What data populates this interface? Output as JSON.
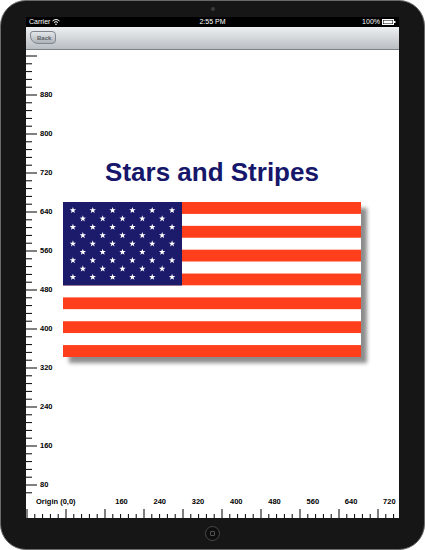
{
  "status_bar": {
    "carrier": "Carrier",
    "time": "2:55 PM",
    "battery": "100%",
    "battery_level": 1
  },
  "nav_bar": {
    "back_button": "Back"
  },
  "title": "Stars and Stripes",
  "vertical_ruler": {
    "labels": [
      "880",
      "800",
      "720",
      "640",
      "560",
      "480",
      "400",
      "320",
      "240",
      "160",
      "80"
    ]
  },
  "horizontal_ruler": {
    "origin": "Origin (0,0)",
    "labels": [
      "160",
      "240",
      "320",
      "400",
      "480",
      "560",
      "640",
      "720"
    ]
  }
}
